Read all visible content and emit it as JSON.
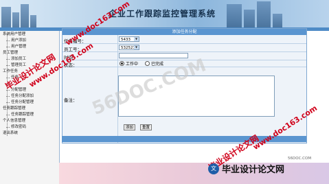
{
  "header": {
    "title": "企业工作跟踪监控管理系统"
  },
  "sidebar": {
    "items": [
      {
        "label": "系统用户管理",
        "level": 0
      },
      {
        "label": "用户添加",
        "level": 1
      },
      {
        "label": "用户管理",
        "level": 1
      },
      {
        "label": "员工管理",
        "level": 0
      },
      {
        "label": "添加员工",
        "level": 1
      },
      {
        "label": "管理员工",
        "level": 1
      },
      {
        "label": "工作任务",
        "level": 0
      },
      {
        "label": "任务...",
        "level": 1
      },
      {
        "label": "...",
        "level": 1
      },
      {
        "label": "分配管理",
        "level": 1
      },
      {
        "label": "任务分配添加",
        "level": 1
      },
      {
        "label": "任务分配管理",
        "level": 1
      },
      {
        "label": "任务跟踪管理",
        "level": 0
      },
      {
        "label": "任务跟踪管理",
        "level": 1
      },
      {
        "label": "个人信息管理",
        "level": 0
      },
      {
        "label": "修改密码",
        "level": 1
      },
      {
        "label": "退出系统",
        "level": 0
      }
    ]
  },
  "form": {
    "title": "添加任务分配",
    "task_id_label": "任务编号：",
    "task_id_value": "5433",
    "employee_label": "员工号：",
    "employee_value": "532523",
    "time_label": "时间：",
    "status_label": "状态：",
    "status_options": [
      "工作中",
      "已完成"
    ],
    "status_selected": "工作中",
    "remark_label": "备注：",
    "add_button": "添加",
    "reset_button": "重置"
  },
  "watermarks": {
    "red_text": "毕业设计论文网",
    "red_url": "www.doc163.com",
    "gray_url": "56DOC.COM",
    "logo_text": "毕业设计论文网",
    "site": "56DOC.COM"
  }
}
